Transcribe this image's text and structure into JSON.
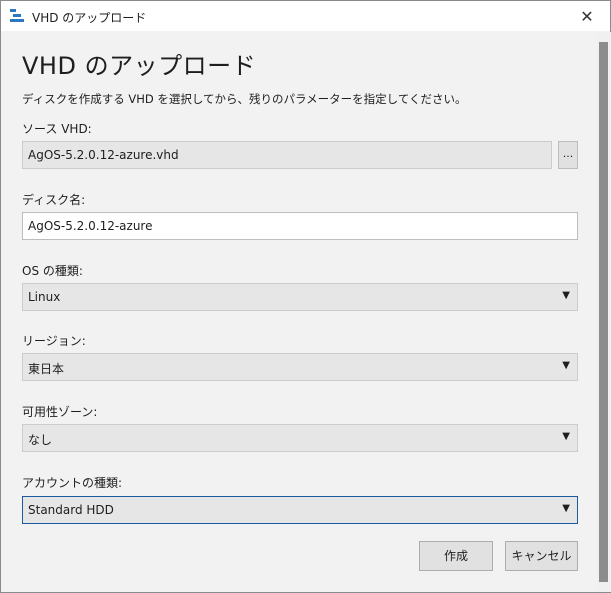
{
  "window": {
    "title": "VHD のアップロード",
    "close_glyph": "✕",
    "icon": "upload-app-icon"
  },
  "page": {
    "heading": "VHD のアップロード",
    "description": "ディスクを作成する VHD を選択してから、残りのパラメーターを指定してください。"
  },
  "form": {
    "source_vhd": {
      "label": "ソース VHD:",
      "value": "AgOS-5.2.0.12-azure.vhd",
      "browse_label": "..."
    },
    "disk_name": {
      "label": "ディスク名:",
      "value": "AgOS-5.2.0.12-azure"
    },
    "os_type": {
      "label": "OS の種類:",
      "value": "Linux"
    },
    "region": {
      "label": "リージョン:",
      "value": "東日本"
    },
    "availability_zone": {
      "label": "可用性ゾーン:",
      "value": "なし"
    },
    "account_type": {
      "label": "アカウントの種類:",
      "value": "Standard HDD"
    }
  },
  "buttons": {
    "create": "作成",
    "cancel": "キャンセル"
  },
  "dropdown_caret": "▼"
}
